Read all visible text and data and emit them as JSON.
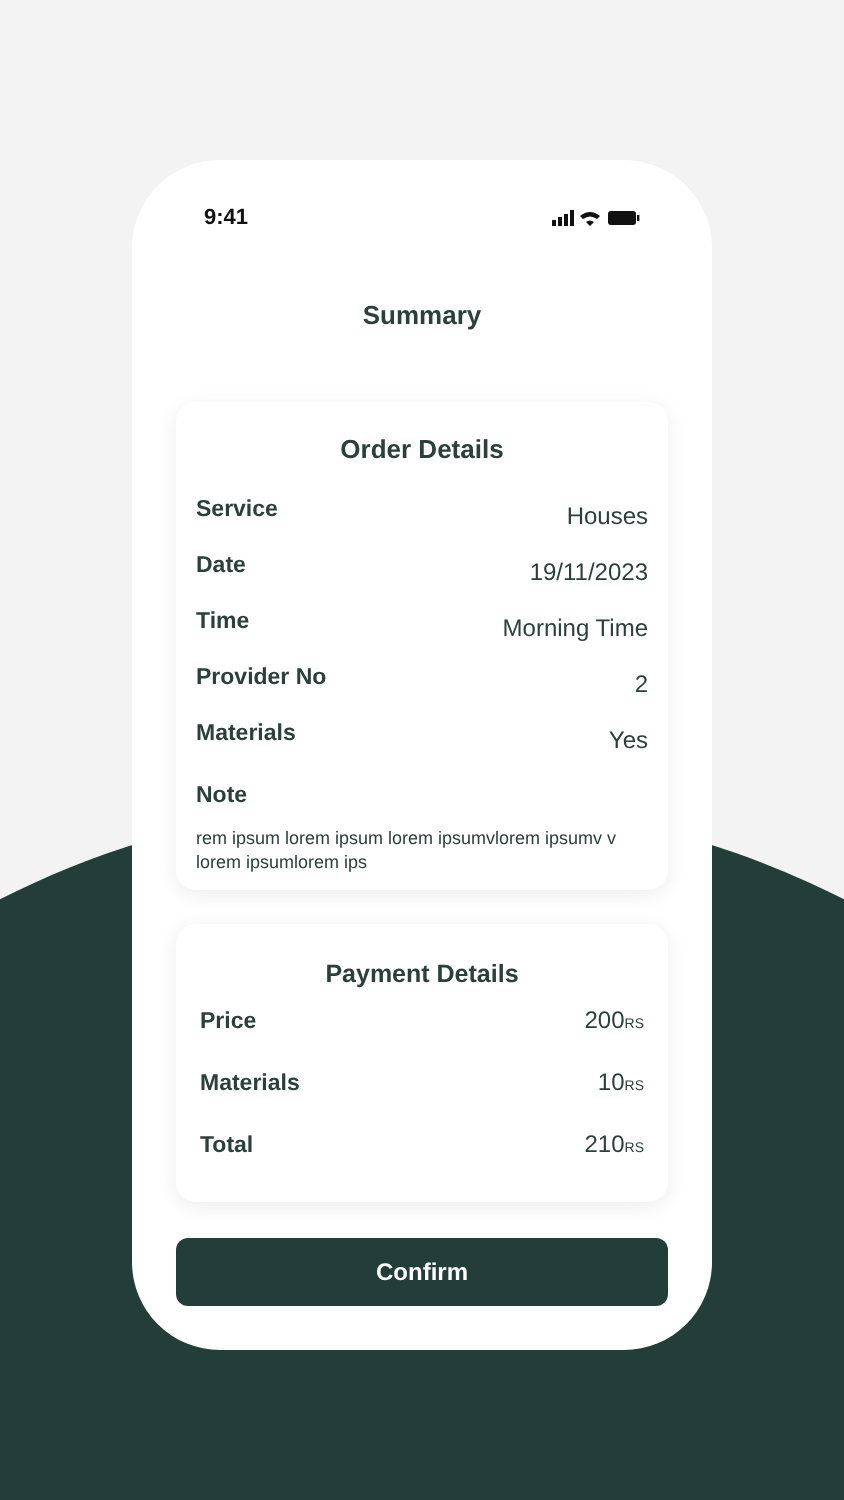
{
  "status_bar": {
    "time": "9:41"
  },
  "title": "Summary",
  "order_details": {
    "heading": "Order Details",
    "rows": [
      {
        "label": "Service",
        "value": "Houses"
      },
      {
        "label": "Date",
        "value": "19/11/2023"
      },
      {
        "label": "Time",
        "value": "Morning Time"
      },
      {
        "label": "Provider No",
        "value": "2"
      },
      {
        "label": "Materials",
        "value": "Yes"
      }
    ],
    "note": {
      "label": "Note",
      "text": "rem ipsum lorem ipsum lorem ipsumvlorem ipsumv v lorem ipsumlorem ips"
    }
  },
  "payment_details": {
    "heading": "Payment Details",
    "rows": [
      {
        "label": "Price",
        "amount": "200",
        "unit": "RS"
      },
      {
        "label": "Materials",
        "amount": "10",
        "unit": "RS"
      },
      {
        "label": "Total",
        "amount": "210",
        "unit": "RS"
      }
    ]
  },
  "confirm_button": "Confirm"
}
